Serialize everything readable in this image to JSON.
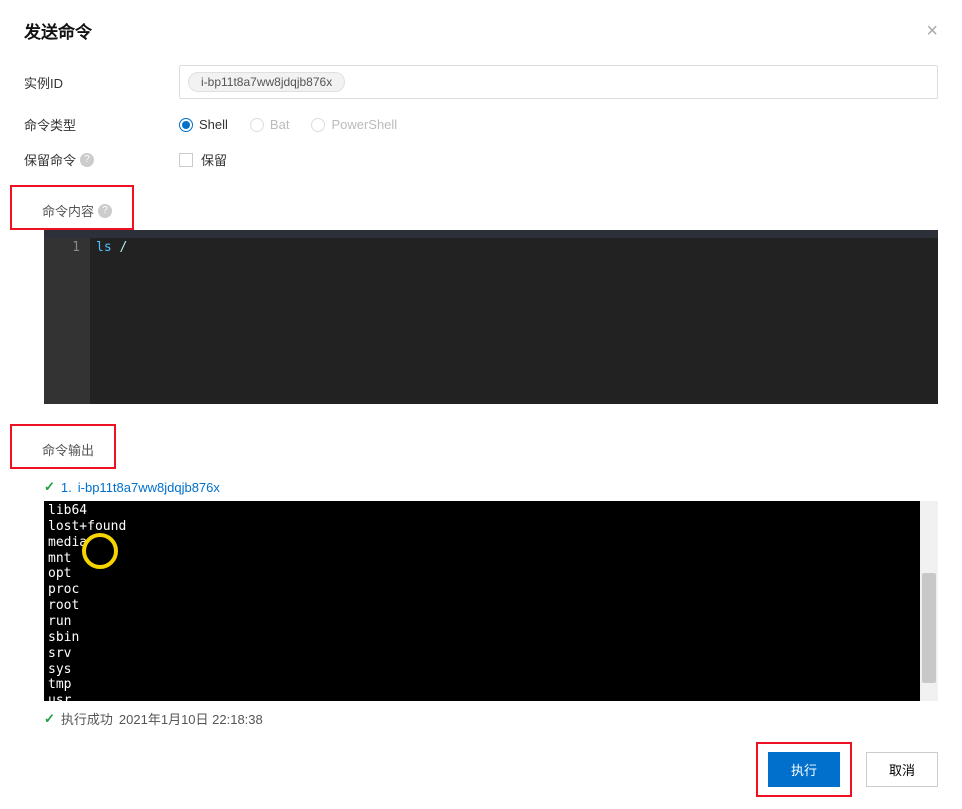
{
  "dialog": {
    "title": "发送命令",
    "close_aria": "close"
  },
  "form": {
    "instance_id_label": "实例ID",
    "instance_id_value": "i-bp11t8a7ww8jdqjb876x",
    "command_type_label": "命令类型",
    "command_type_options": {
      "shell": "Shell",
      "bat": "Bat",
      "powershell": "PowerShell"
    },
    "save_command_label": "保留命令",
    "save_checkbox_label": "保留"
  },
  "sections": {
    "command_content_label": "命令内容",
    "command_output_label": "命令输出"
  },
  "editor": {
    "line_number": "1",
    "code_command": "ls",
    "code_arg": "/"
  },
  "output": {
    "result_index": "1.",
    "result_instance": "i-bp11t8a7ww8jdqjb876x",
    "lines": "lib64\nlost+found\nmedia\nmnt\nopt\nproc\nroot\nrun\nsbin\nsrv\nsys\ntmp\nusr\nvar",
    "status_label": "执行成功",
    "status_time": "2021年1月10日 22:18:38"
  },
  "footer": {
    "execute_label": "执行",
    "cancel_label": "取消"
  }
}
